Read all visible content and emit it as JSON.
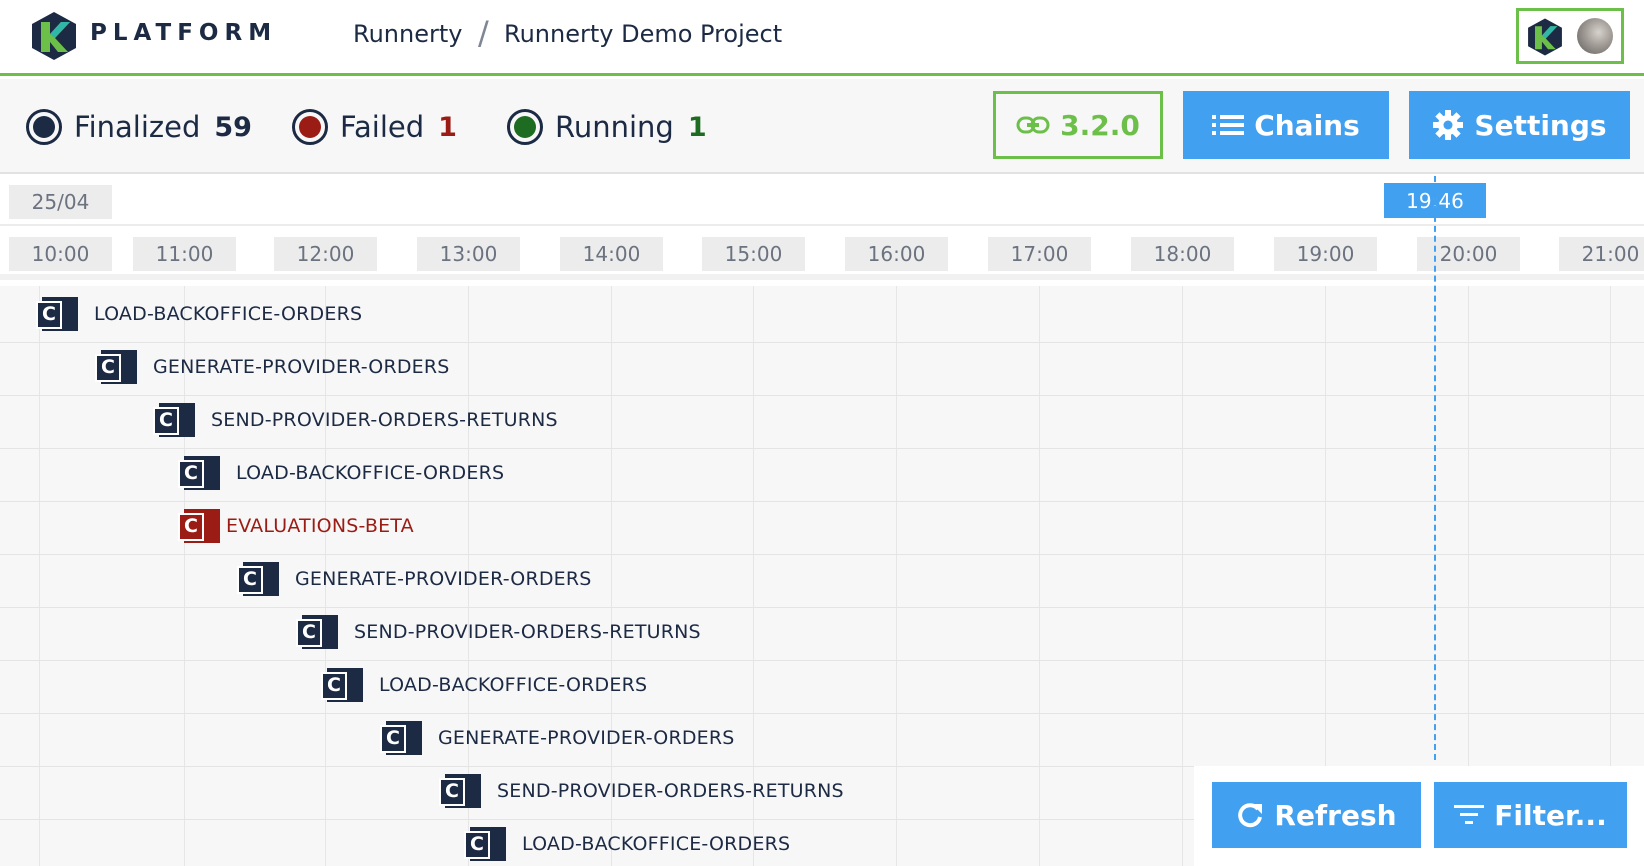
{
  "header": {
    "brand": "PLATFORM",
    "breadcrumb": [
      "Runnerty",
      "Runnerty Demo Project"
    ],
    "separator": "/"
  },
  "status": {
    "finalized": {
      "label": "Finalized",
      "count": "59",
      "color": "#1c2a44"
    },
    "failed": {
      "label": "Failed",
      "count": "1",
      "color": "#9b1c15"
    },
    "running": {
      "label": "Running",
      "count": "1",
      "color": "#1e6b22"
    }
  },
  "toolbar": {
    "version_label": "3.2.0",
    "chains_label": "Chains",
    "settings_label": "Settings"
  },
  "timeline": {
    "date": "25/04",
    "now": "19:46",
    "hours": [
      "10:00",
      "11:00",
      "12:00",
      "13:00",
      "14:00",
      "15:00",
      "16:00",
      "17:00",
      "18:00",
      "19:00",
      "20:00",
      "21:00"
    ]
  },
  "chains": [
    {
      "name": "LOAD-BACKOFFICE-ORDERS",
      "status": "finalized"
    },
    {
      "name": "GENERATE-PROVIDER-ORDERS",
      "status": "finalized"
    },
    {
      "name": "SEND-PROVIDER-ORDERS-RETURNS",
      "status": "finalized"
    },
    {
      "name": "LOAD-BACKOFFICE-ORDERS",
      "status": "finalized"
    },
    {
      "name": "EVALUATIONS-BETA",
      "status": "failed"
    },
    {
      "name": "GENERATE-PROVIDER-ORDERS",
      "status": "finalized"
    },
    {
      "name": "SEND-PROVIDER-ORDERS-RETURNS",
      "status": "finalized"
    },
    {
      "name": "LOAD-BACKOFFICE-ORDERS",
      "status": "finalized"
    },
    {
      "name": "GENERATE-PROVIDER-ORDERS",
      "status": "finalized"
    },
    {
      "name": "SEND-PROVIDER-ORDERS-RETURNS",
      "status": "finalized"
    },
    {
      "name": "LOAD-BACKOFFICE-ORDERS",
      "status": "finalized"
    }
  ],
  "chain_icon_letter": "C",
  "actions": {
    "refresh_label": "Refresh",
    "filter_label": "Filter..."
  },
  "colors": {
    "accent": "#41a0f0",
    "brand_green": "#6cc04a",
    "navy": "#1c2a44",
    "failed": "#9b1c15"
  }
}
